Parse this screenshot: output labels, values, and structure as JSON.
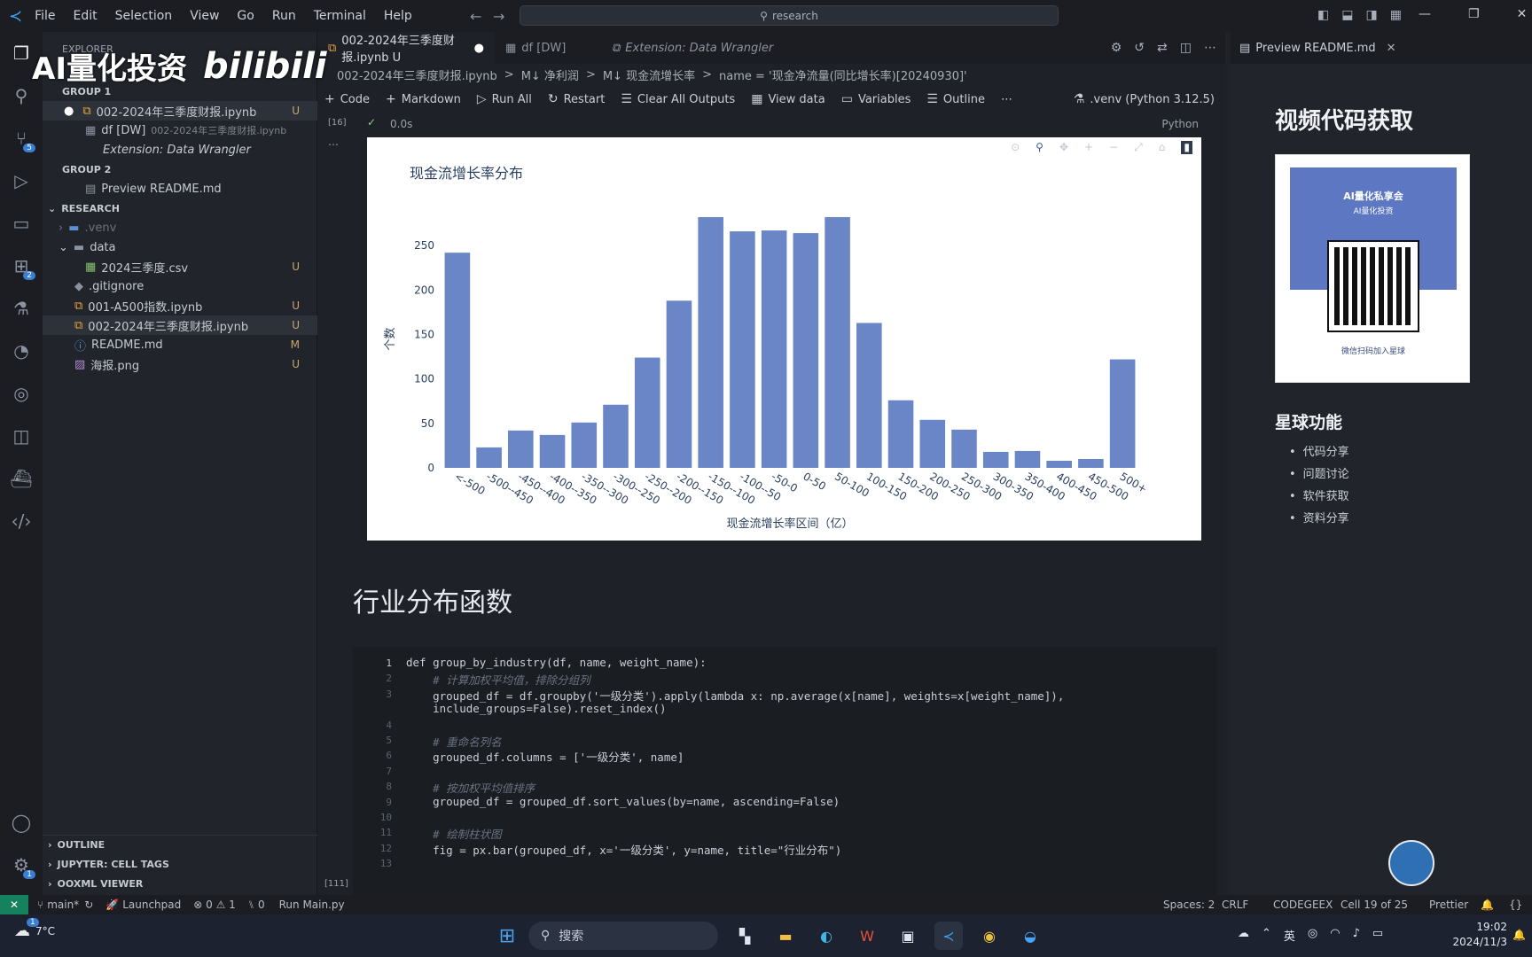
{
  "titlebar": {
    "menu": [
      "File",
      "Edit",
      "Selection",
      "View",
      "Go",
      "Run",
      "Terminal",
      "Help"
    ],
    "search_text": "research",
    "watermark_text": "AI量化投资",
    "watermark_logo": "bilibili"
  },
  "sidebar": {
    "explorer_label": "EXPLORER",
    "group1_label": "GROUP 1",
    "group1_items": [
      {
        "label": "002-2024年三季度财报.ipynb",
        "badge": "U"
      },
      {
        "label": "df [DW]",
        "sub": "002-2024年三季度财报.ipynb"
      },
      {
        "label": "Extension: Data Wrangler"
      }
    ],
    "group2_label": "GROUP 2",
    "group2_items": [
      {
        "label": "Preview README.md"
      }
    ],
    "research_label": "RESEARCH",
    "research_items": [
      {
        "label": ".venv",
        "badge": ""
      },
      {
        "label": "data",
        "badge": ""
      },
      {
        "label": "2024三季度.csv",
        "badge": "U"
      },
      {
        "label": ".gitignore",
        "badge": ""
      },
      {
        "label": "001-A500指数.ipynb",
        "badge": "U"
      },
      {
        "label": "002-2024年三季度财报.ipynb",
        "badge": "U"
      },
      {
        "label": "README.md",
        "badge": "M"
      },
      {
        "label": "海报.png",
        "badge": "U"
      }
    ],
    "outline_label": "OUTLINE",
    "cell_tags_label": "JUPYTER: CELL TAGS",
    "ooxml_label": "OOXML VIEWER",
    "source_control_badge": "5",
    "extensions_badge": "2",
    "settings_badge": "1"
  },
  "editor": {
    "tabs": [
      {
        "label": "002-2024年三季度财报.ipynb U",
        "active": true
      },
      {
        "label": "df [DW]",
        "active": false
      },
      {
        "label": "Extension: Data Wrangler",
        "active": false
      }
    ],
    "breadcrumb": [
      "002-2024年三季度财报.ipynb",
      ">",
      "M↓ 净利润",
      ">",
      "M↓ 现金流增长率",
      ">",
      "name = '现金净流量(同比增长率)[20240930]'"
    ],
    "toolbar": {
      "code": "Code",
      "markdown": "Markdown",
      "run_all": "Run All",
      "restart": "Restart",
      "clear": "Clear All Outputs",
      "view_data": "View data",
      "variables": "Variables",
      "outline": "Outline",
      "kernel": ".venv (Python 3.12.5)"
    },
    "cell_exec": {
      "count": "[16]",
      "time": "0.0s",
      "lang": "Python"
    },
    "markdown_heading": "行业分布函数",
    "code_exec_count": "[111]",
    "code_lines": [
      {
        "n": "1",
        "text": "def group_by_industry(df, name, weight_name):"
      },
      {
        "n": "2",
        "text": "    # 计算加权平均值，排除分组列"
      },
      {
        "n": "3",
        "text": "    grouped_df = df.groupby('一级分类').apply(lambda x: np.average(x[name], weights=x[weight_name]),"
      },
      {
        "n": "",
        "text": "    include_groups=False).reset_index()"
      },
      {
        "n": "4",
        "text": ""
      },
      {
        "n": "5",
        "text": "    # 重命名列名"
      },
      {
        "n": "6",
        "text": "    grouped_df.columns = ['一级分类', name]"
      },
      {
        "n": "7",
        "text": ""
      },
      {
        "n": "8",
        "text": "    # 按加权平均值排序"
      },
      {
        "n": "9",
        "text": "    grouped_df = grouped_df.sort_values(by=name, ascending=False)"
      },
      {
        "n": "10",
        "text": ""
      },
      {
        "n": "11",
        "text": "    # 绘制柱状图"
      },
      {
        "n": "12",
        "text": "    fig = px.bar(grouped_df, x='一级分类', y=name, title=\"行业分布\")"
      },
      {
        "n": "13",
        "text": ""
      }
    ]
  },
  "chart_data": {
    "type": "bar",
    "title": "现金流增长率分布",
    "xlabel": "现金流增长率区间（亿）",
    "ylabel": "个数",
    "ylim": [
      0,
      290
    ],
    "yticks": [
      0,
      50,
      100,
      150,
      200,
      250
    ],
    "categories": [
      "<-500",
      "-500--450",
      "-450--400",
      "-400--350",
      "-350--300",
      "-300--250",
      "-250--200",
      "-200--150",
      "-150--100",
      "-100--50",
      "-50-0",
      "0-50",
      "50-100",
      "100-150",
      "150-200",
      "200-250",
      "250-300",
      "300-350",
      "350-400",
      "400-450",
      "450-500",
      "500+"
    ],
    "values": [
      242,
      23,
      42,
      37,
      51,
      71,
      124,
      188,
      282,
      266,
      267,
      264,
      282,
      163,
      76,
      54,
      43,
      18,
      19,
      8,
      10,
      122
    ],
    "color": "#6b86c6",
    "grid": false
  },
  "preview": {
    "tab_label": "Preview README.md",
    "heading1": "视频代码获取",
    "qr_card_top": "AI量化私享会",
    "qr_card_sub": "AI量化投资",
    "qr_caption": "微信扫码加入星球",
    "heading2": "星球功能",
    "features": [
      "代码分享",
      "问题讨论",
      "软件获取",
      "资料分享"
    ]
  },
  "statusbar": {
    "branch": "main*",
    "launchpad": "Launchpad",
    "problems": "⊗ 0 ⚠ 1",
    "ports": "0",
    "run": "Run Main.py",
    "spaces": "Spaces: 2",
    "eol": "CRLF",
    "codegeex": "CODEGEEX",
    "cell": "Cell 19 of 25",
    "prettier": "Prettier"
  },
  "taskbar": {
    "weather": "7°C",
    "search": "搜索",
    "ime": "英",
    "time": "19:02",
    "date": "2024/11/3",
    "notify_badge": "1"
  }
}
